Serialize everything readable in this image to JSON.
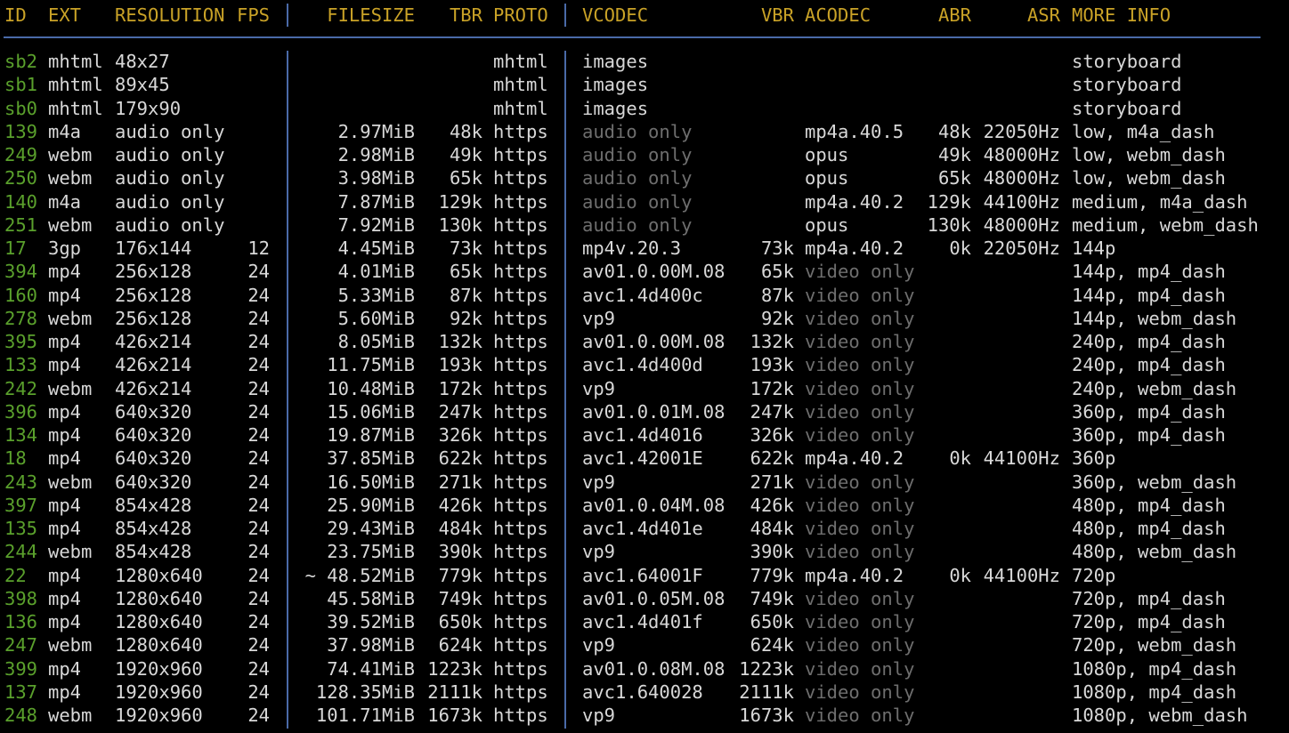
{
  "headers": {
    "id": "ID",
    "ext": "EXT",
    "resolution": "RESOLUTION",
    "fps": "FPS",
    "filesize": "FILESIZE",
    "tbr": "TBR",
    "proto": "PROTO",
    "vcodec": "VCODEC",
    "vbr": "VBR",
    "acodec": "ACODEC",
    "abr": "ABR",
    "asr": "ASR",
    "more": "MORE INFO"
  },
  "rows": [
    {
      "id": "sb2",
      "ext": "mhtml",
      "res": "48x27",
      "fps": "",
      "size": "",
      "tbr": "",
      "proto": "mhtml",
      "vcodec": "images",
      "vbr": "",
      "acodec": "",
      "abr": "",
      "asr": "",
      "more": "storyboard"
    },
    {
      "id": "sb1",
      "ext": "mhtml",
      "res": "89x45",
      "fps": "",
      "size": "",
      "tbr": "",
      "proto": "mhtml",
      "vcodec": "images",
      "vbr": "",
      "acodec": "",
      "abr": "",
      "asr": "",
      "more": "storyboard"
    },
    {
      "id": "sb0",
      "ext": "mhtml",
      "res": "179x90",
      "fps": "",
      "size": "",
      "tbr": "",
      "proto": "mhtml",
      "vcodec": "images",
      "vbr": "",
      "acodec": "",
      "abr": "",
      "asr": "",
      "more": "storyboard"
    },
    {
      "id": "139",
      "ext": "m4a",
      "res": "audio only",
      "fps": "",
      "size": "2.97MiB",
      "tbr": "48k",
      "proto": "https",
      "vcodec": "audio only",
      "vbr": "",
      "acodec": "mp4a.40.5",
      "abr": "48k",
      "asr": "22050Hz",
      "more": "low, m4a_dash"
    },
    {
      "id": "249",
      "ext": "webm",
      "res": "audio only",
      "fps": "",
      "size": "2.98MiB",
      "tbr": "49k",
      "proto": "https",
      "vcodec": "audio only",
      "vbr": "",
      "acodec": "opus",
      "abr": "49k",
      "asr": "48000Hz",
      "more": "low, webm_dash"
    },
    {
      "id": "250",
      "ext": "webm",
      "res": "audio only",
      "fps": "",
      "size": "3.98MiB",
      "tbr": "65k",
      "proto": "https",
      "vcodec": "audio only",
      "vbr": "",
      "acodec": "opus",
      "abr": "65k",
      "asr": "48000Hz",
      "more": "low, webm_dash"
    },
    {
      "id": "140",
      "ext": "m4a",
      "res": "audio only",
      "fps": "",
      "size": "7.87MiB",
      "tbr": "129k",
      "proto": "https",
      "vcodec": "audio only",
      "vbr": "",
      "acodec": "mp4a.40.2",
      "abr": "129k",
      "asr": "44100Hz",
      "more": "medium, m4a_dash"
    },
    {
      "id": "251",
      "ext": "webm",
      "res": "audio only",
      "fps": "",
      "size": "7.92MiB",
      "tbr": "130k",
      "proto": "https",
      "vcodec": "audio only",
      "vbr": "",
      "acodec": "opus",
      "abr": "130k",
      "asr": "48000Hz",
      "more": "medium, webm_dash"
    },
    {
      "id": "17",
      "ext": "3gp",
      "res": "176x144",
      "fps": "12",
      "size": "4.45MiB",
      "tbr": "73k",
      "proto": "https",
      "vcodec": "mp4v.20.3",
      "vbr": "73k",
      "acodec": "mp4a.40.2",
      "abr": "0k",
      "asr": "22050Hz",
      "more": "144p"
    },
    {
      "id": "394",
      "ext": "mp4",
      "res": "256x128",
      "fps": "24",
      "size": "4.01MiB",
      "tbr": "65k",
      "proto": "https",
      "vcodec": "av01.0.00M.08",
      "vbr": "65k",
      "acodec": "video only",
      "abr": "",
      "asr": "",
      "more": "144p, mp4_dash"
    },
    {
      "id": "160",
      "ext": "mp4",
      "res": "256x128",
      "fps": "24",
      "size": "5.33MiB",
      "tbr": "87k",
      "proto": "https",
      "vcodec": "avc1.4d400c",
      "vbr": "87k",
      "acodec": "video only",
      "abr": "",
      "asr": "",
      "more": "144p, mp4_dash"
    },
    {
      "id": "278",
      "ext": "webm",
      "res": "256x128",
      "fps": "24",
      "size": "5.60MiB",
      "tbr": "92k",
      "proto": "https",
      "vcodec": "vp9",
      "vbr": "92k",
      "acodec": "video only",
      "abr": "",
      "asr": "",
      "more": "144p, webm_dash"
    },
    {
      "id": "395",
      "ext": "mp4",
      "res": "426x214",
      "fps": "24",
      "size": "8.05MiB",
      "tbr": "132k",
      "proto": "https",
      "vcodec": "av01.0.00M.08",
      "vbr": "132k",
      "acodec": "video only",
      "abr": "",
      "asr": "",
      "more": "240p, mp4_dash"
    },
    {
      "id": "133",
      "ext": "mp4",
      "res": "426x214",
      "fps": "24",
      "size": "11.75MiB",
      "tbr": "193k",
      "proto": "https",
      "vcodec": "avc1.4d400d",
      "vbr": "193k",
      "acodec": "video only",
      "abr": "",
      "asr": "",
      "more": "240p, mp4_dash"
    },
    {
      "id": "242",
      "ext": "webm",
      "res": "426x214",
      "fps": "24",
      "size": "10.48MiB",
      "tbr": "172k",
      "proto": "https",
      "vcodec": "vp9",
      "vbr": "172k",
      "acodec": "video only",
      "abr": "",
      "asr": "",
      "more": "240p, webm_dash"
    },
    {
      "id": "396",
      "ext": "mp4",
      "res": "640x320",
      "fps": "24",
      "size": "15.06MiB",
      "tbr": "247k",
      "proto": "https",
      "vcodec": "av01.0.01M.08",
      "vbr": "247k",
      "acodec": "video only",
      "abr": "",
      "asr": "",
      "more": "360p, mp4_dash"
    },
    {
      "id": "134",
      "ext": "mp4",
      "res": "640x320",
      "fps": "24",
      "size": "19.87MiB",
      "tbr": "326k",
      "proto": "https",
      "vcodec": "avc1.4d4016",
      "vbr": "326k",
      "acodec": "video only",
      "abr": "",
      "asr": "",
      "more": "360p, mp4_dash"
    },
    {
      "id": "18",
      "ext": "mp4",
      "res": "640x320",
      "fps": "24",
      "size": "37.85MiB",
      "tbr": "622k",
      "proto": "https",
      "vcodec": "avc1.42001E",
      "vbr": "622k",
      "acodec": "mp4a.40.2",
      "abr": "0k",
      "asr": "44100Hz",
      "more": "360p"
    },
    {
      "id": "243",
      "ext": "webm",
      "res": "640x320",
      "fps": "24",
      "size": "16.50MiB",
      "tbr": "271k",
      "proto": "https",
      "vcodec": "vp9",
      "vbr": "271k",
      "acodec": "video only",
      "abr": "",
      "asr": "",
      "more": "360p, webm_dash"
    },
    {
      "id": "397",
      "ext": "mp4",
      "res": "854x428",
      "fps": "24",
      "size": "25.90MiB",
      "tbr": "426k",
      "proto": "https",
      "vcodec": "av01.0.04M.08",
      "vbr": "426k",
      "acodec": "video only",
      "abr": "",
      "asr": "",
      "more": "480p, mp4_dash"
    },
    {
      "id": "135",
      "ext": "mp4",
      "res": "854x428",
      "fps": "24",
      "size": "29.43MiB",
      "tbr": "484k",
      "proto": "https",
      "vcodec": "avc1.4d401e",
      "vbr": "484k",
      "acodec": "video only",
      "abr": "",
      "asr": "",
      "more": "480p, mp4_dash"
    },
    {
      "id": "244",
      "ext": "webm",
      "res": "854x428",
      "fps": "24",
      "size": "23.75MiB",
      "tbr": "390k",
      "proto": "https",
      "vcodec": "vp9",
      "vbr": "390k",
      "acodec": "video only",
      "abr": "",
      "asr": "",
      "more": "480p, webm_dash"
    },
    {
      "id": "22",
      "ext": "mp4",
      "res": "1280x640",
      "fps": "24",
      "size": "~ 48.52MiB",
      "tbr": "779k",
      "proto": "https",
      "vcodec": "avc1.64001F",
      "vbr": "779k",
      "acodec": "mp4a.40.2",
      "abr": "0k",
      "asr": "44100Hz",
      "more": "720p"
    },
    {
      "id": "398",
      "ext": "mp4",
      "res": "1280x640",
      "fps": "24",
      "size": "45.58MiB",
      "tbr": "749k",
      "proto": "https",
      "vcodec": "av01.0.05M.08",
      "vbr": "749k",
      "acodec": "video only",
      "abr": "",
      "asr": "",
      "more": "720p, mp4_dash"
    },
    {
      "id": "136",
      "ext": "mp4",
      "res": "1280x640",
      "fps": "24",
      "size": "39.52MiB",
      "tbr": "650k",
      "proto": "https",
      "vcodec": "avc1.4d401f",
      "vbr": "650k",
      "acodec": "video only",
      "abr": "",
      "asr": "",
      "more": "720p, mp4_dash"
    },
    {
      "id": "247",
      "ext": "webm",
      "res": "1280x640",
      "fps": "24",
      "size": "37.98MiB",
      "tbr": "624k",
      "proto": "https",
      "vcodec": "vp9",
      "vbr": "624k",
      "acodec": "video only",
      "abr": "",
      "asr": "",
      "more": "720p, webm_dash"
    },
    {
      "id": "399",
      "ext": "mp4",
      "res": "1920x960",
      "fps": "24",
      "size": "74.41MiB",
      "tbr": "1223k",
      "proto": "https",
      "vcodec": "av01.0.08M.08",
      "vbr": "1223k",
      "acodec": "video only",
      "abr": "",
      "asr": "",
      "more": "1080p, mp4_dash"
    },
    {
      "id": "137",
      "ext": "mp4",
      "res": "1920x960",
      "fps": "24",
      "size": "128.35MiB",
      "tbr": "2111k",
      "proto": "https",
      "vcodec": "avc1.640028",
      "vbr": "2111k",
      "acodec": "video only",
      "abr": "",
      "asr": "",
      "more": "1080p, mp4_dash"
    },
    {
      "id": "248",
      "ext": "webm",
      "res": "1920x960",
      "fps": "24",
      "size": "101.71MiB",
      "tbr": "1673k",
      "proto": "https",
      "vcodec": "vp9",
      "vbr": "1673k",
      "acodec": "video only",
      "abr": "",
      "asr": "",
      "more": "1080p, webm_dash"
    }
  ],
  "colors": {
    "background": "#000000",
    "text": "#d8d8d8",
    "header": "#c9a227",
    "id": "#5aa02c",
    "dim": "#6e6e6e",
    "separator": "#4a6aa8"
  }
}
